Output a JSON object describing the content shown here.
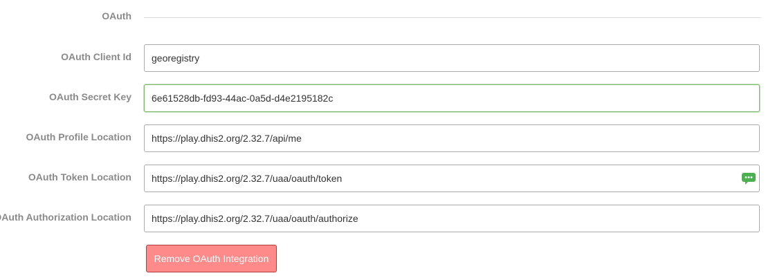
{
  "section": {
    "title": "OAuth"
  },
  "fields": [
    {
      "label": "OAuth Client Id",
      "value": "georegistry"
    },
    {
      "label": "OAuth Secret Key",
      "value": "6e61528db-fd93-44ac-0a5d-d4e2195182c"
    },
    {
      "label": "OAuth Profile Location",
      "value": "https://play.dhis2.org/2.32.7/api/me"
    },
    {
      "label": "OAuth Token Location",
      "value": "https://play.dhis2.org/2.32.7/uaa/oauth/token"
    },
    {
      "label": "OAuth Authorization Location",
      "value": "https://play.dhis2.org/2.32.7/uaa/oauth/authorize"
    }
  ],
  "actions": {
    "remove_label": "Remove OAuth Integration"
  },
  "icons": {
    "password_manager": "password-manager-icon"
  },
  "colors": {
    "label": "#8a8a8a",
    "input_border": "#a9a9a9",
    "focus_border": "#7cb66f",
    "remove_button_bg": "#ff8a8a",
    "remove_button_border": "#b33a3a",
    "addon_icon": "#4caf50"
  }
}
